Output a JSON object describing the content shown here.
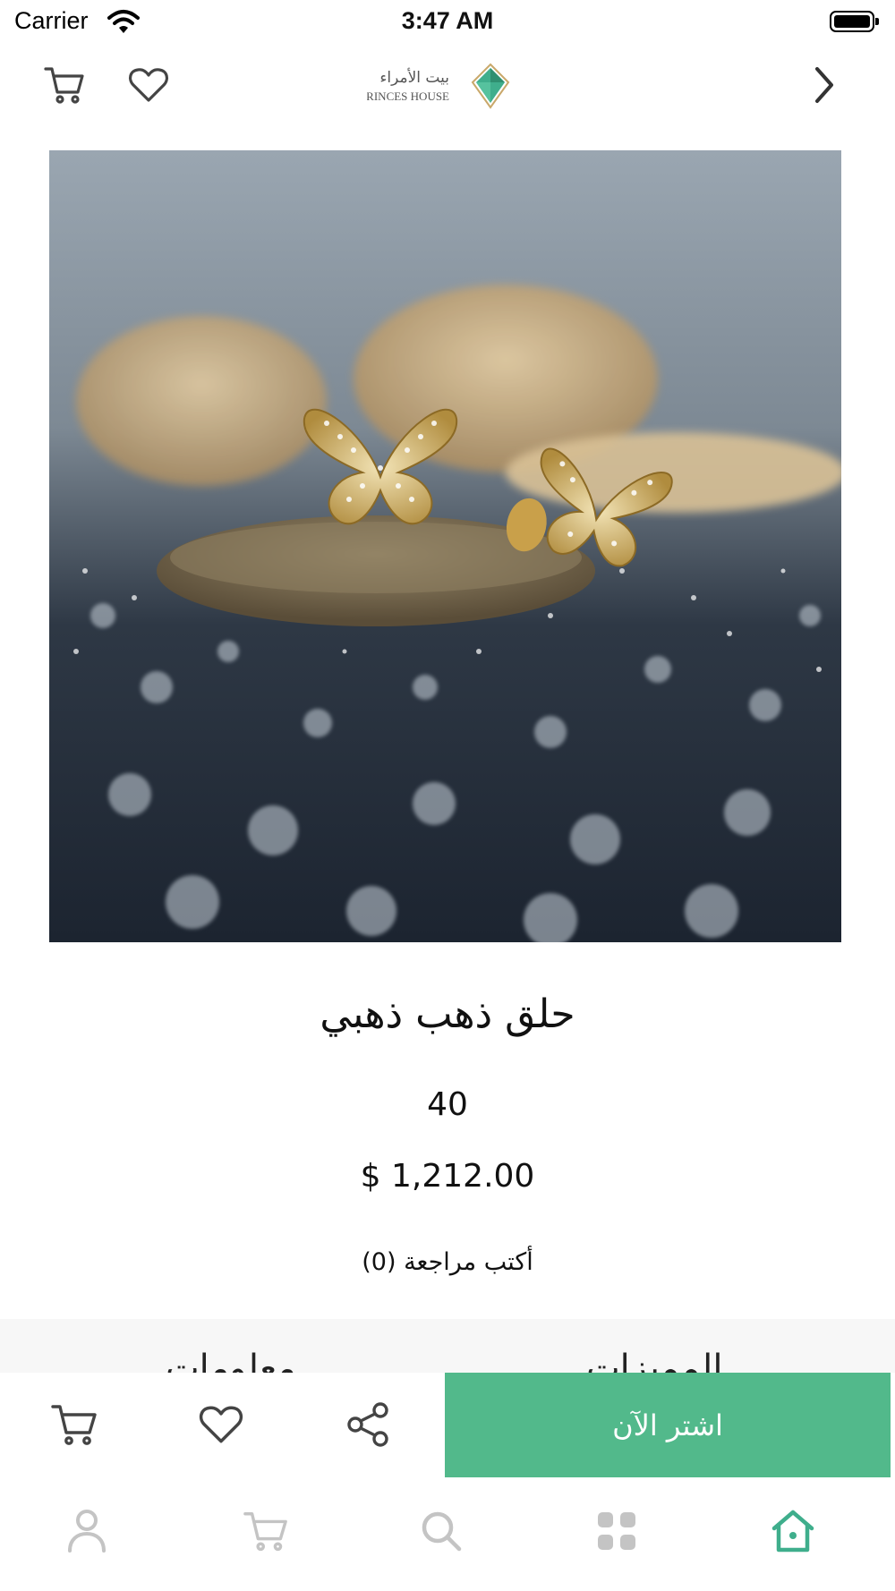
{
  "status_bar": {
    "carrier": "Carrier",
    "time": "3:47 AM"
  },
  "header": {
    "icons": [
      "cart-icon",
      "heart-icon",
      "chevron-right-icon"
    ],
    "logo": {
      "arabic": "بيت الأمراء",
      "english": "PRINCES HOUSE",
      "accent": "#3fae8c"
    }
  },
  "product": {
    "title": "حلق ذهب ذهبي",
    "quantity": "40",
    "price": "$ 1,212.00",
    "reviews": "(0) أكتب مراجعة"
  },
  "tabs": [
    {
      "label": "المميزات"
    },
    {
      "label": "معلومات"
    }
  ],
  "actions": {
    "buy_now_label": "اشتر الآن",
    "icons": [
      "cart-icon",
      "heart-icon",
      "share-icon"
    ]
  },
  "tab_bar": {
    "items": [
      "profile-icon",
      "cart-icon",
      "search-icon",
      "categories-icon",
      "home-icon"
    ],
    "active": "home-icon",
    "active_color": "#3fae8c",
    "inactive_color": "#c4c4c4"
  },
  "colors": {
    "accent": "#52b98b"
  }
}
